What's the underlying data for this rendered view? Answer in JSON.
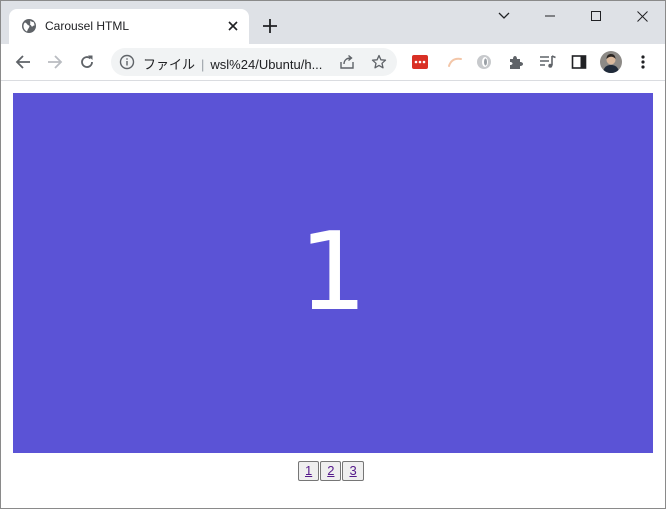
{
  "tab": {
    "title": "Carousel HTML"
  },
  "omnibox": {
    "scheme_label": "ファイル",
    "url": "wsl%24/Ubuntu/h..."
  },
  "carousel": {
    "slide_number": "1",
    "slide_color": "#5b53d6",
    "pages": [
      "1",
      "2",
      "3"
    ]
  },
  "colors": {
    "tabstrip": "#dee1e6",
    "icon": "#5f6368",
    "extension_red": "#d93025"
  }
}
